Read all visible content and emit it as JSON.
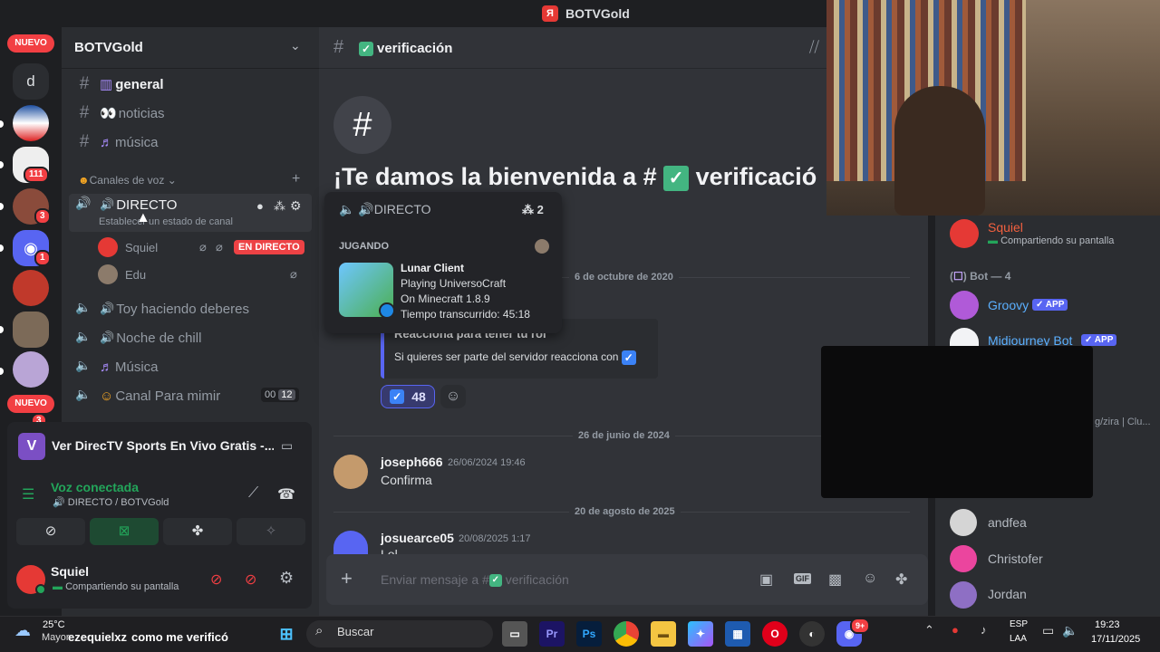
{
  "window": {
    "title": "BOTVGold"
  },
  "server_rail": {
    "new_top": "NUEVO",
    "dm_letter": "d",
    "badge_111": "111",
    "badge_3": "3",
    "badge_1": "1",
    "new_bottom": "NUEVO",
    "badge_bottom": "3"
  },
  "server": {
    "name": "BOTVGold"
  },
  "channels": [
    {
      "label": "general"
    },
    {
      "label": "noticias"
    },
    {
      "label": "música"
    }
  ],
  "voice_category": "Canales de voz",
  "voice_channels": [
    {
      "label": "DIRECTO",
      "status": "Establecer un estado de canal"
    },
    {
      "label": "Toy haciendo deberes"
    },
    {
      "label": "Noche de chill"
    },
    {
      "label": "Música"
    },
    {
      "label": "Canal Para mimir",
      "count_a": "00",
      "count_b": "12"
    }
  ],
  "voice_users": [
    {
      "name": "Squiel",
      "badge": "EN DIRECTO"
    },
    {
      "name": "Edu"
    }
  ],
  "activity": {
    "title": "Ver DirecTV Sports En Vivo Gratis -..."
  },
  "voice_status": {
    "title": "Voz conectada",
    "sub": "DIRECTO / BOTVGold"
  },
  "user": {
    "name": "Squiel",
    "status": "Compartiendo su pantalla"
  },
  "channel_header": {
    "name": "verificación"
  },
  "welcome": {
    "title": "¡Te damos la bienvenida a #",
    "channel": "verificació"
  },
  "popout": {
    "channel": "DIRECTO",
    "count": "2",
    "section": "JUGANDO",
    "game": "Lunar Client",
    "line1": "Playing UniversoCraft",
    "line2": "On Minecraft 1.8.9",
    "line3": "Tiempo transcurrido: 45:18"
  },
  "messages": {
    "date1": "6 de octubre de 2020",
    "embed_title": "Reacciona para tener tu rol",
    "embed_body": "Si quieres ser parte del servidor reacciona con",
    "reaction_count": "48",
    "date2": "26 de junio de 2024",
    "msg1_author": "joseph666",
    "msg1_time": "26/06/2024 19:46",
    "msg1_text": "Confirma",
    "date3": "20 de agosto de 2025",
    "msg2_author": "josuearce05",
    "msg2_time": "20/08/2025 1:17",
    "msg2_text": "Lol"
  },
  "input": {
    "placeholder": "Enviar mensaje a #",
    "channel": "verificación"
  },
  "members": {
    "top_name": "Squiel",
    "top_status": "Compartiendo su pantalla",
    "bot_header": "Bot — 4",
    "bots": [
      {
        "name": "Groovy",
        "tag": "APP"
      },
      {
        "name": "Midiourney Bot",
        "tag": "APP"
      }
    ],
    "side_text": "g/zira | Clu...",
    "users": [
      "andfea",
      "Christofer",
      "Jordan"
    ]
  },
  "taskbar": {
    "temp": "25°C",
    "weather_sub": "Mayor",
    "overlay_user": "ezequielxz",
    "overlay_text": "como me verificó",
    "search": "Buscar",
    "lang_1": "ESP",
    "lang_2": "LAA",
    "time": "19:23",
    "date": "17/11/2025",
    "discord_badge": "9+"
  }
}
